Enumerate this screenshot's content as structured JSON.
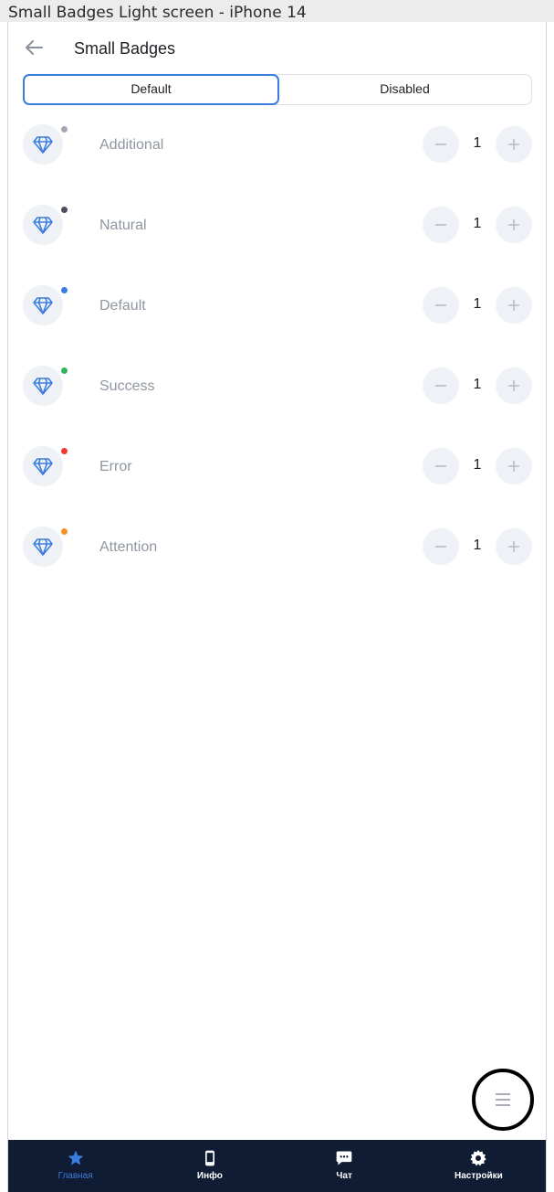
{
  "window_title": "Small Badges Light screen - iPhone 14",
  "header": {
    "title": "Small Badges"
  },
  "segmented": {
    "options": [
      "Default",
      "Disabled"
    ],
    "selected": "Default"
  },
  "rows": [
    {
      "label": "Additional",
      "badge_color": "#a3a8b3",
      "value": "1"
    },
    {
      "label": "Natural",
      "badge_color": "#4b4f5c",
      "value": "1"
    },
    {
      "label": "Default",
      "badge_color": "#3b7ddd",
      "value": "1"
    },
    {
      "label": "Success",
      "badge_color": "#34b262",
      "value": "1"
    },
    {
      "label": "Error",
      "badge_color": "#ef3b2f",
      "value": "1"
    },
    {
      "label": "Attention",
      "badge_color": "#f4922b",
      "value": "1"
    }
  ],
  "row_icon": "diamond-icon",
  "fab_icon": "menu-icon",
  "tabbar": {
    "items": [
      {
        "label": "Главная",
        "icon": "star-icon",
        "active": true
      },
      {
        "label": "Инфо",
        "icon": "phone-icon",
        "active": false
      },
      {
        "label": "Чат",
        "icon": "chat-icon",
        "active": false
      },
      {
        "label": "Настройки",
        "icon": "gear-icon",
        "active": false
      }
    ]
  },
  "colors": {
    "accent": "#3b7ddd",
    "tabbar_bg": "#0f1c33",
    "muted_text": "#9096a0"
  }
}
